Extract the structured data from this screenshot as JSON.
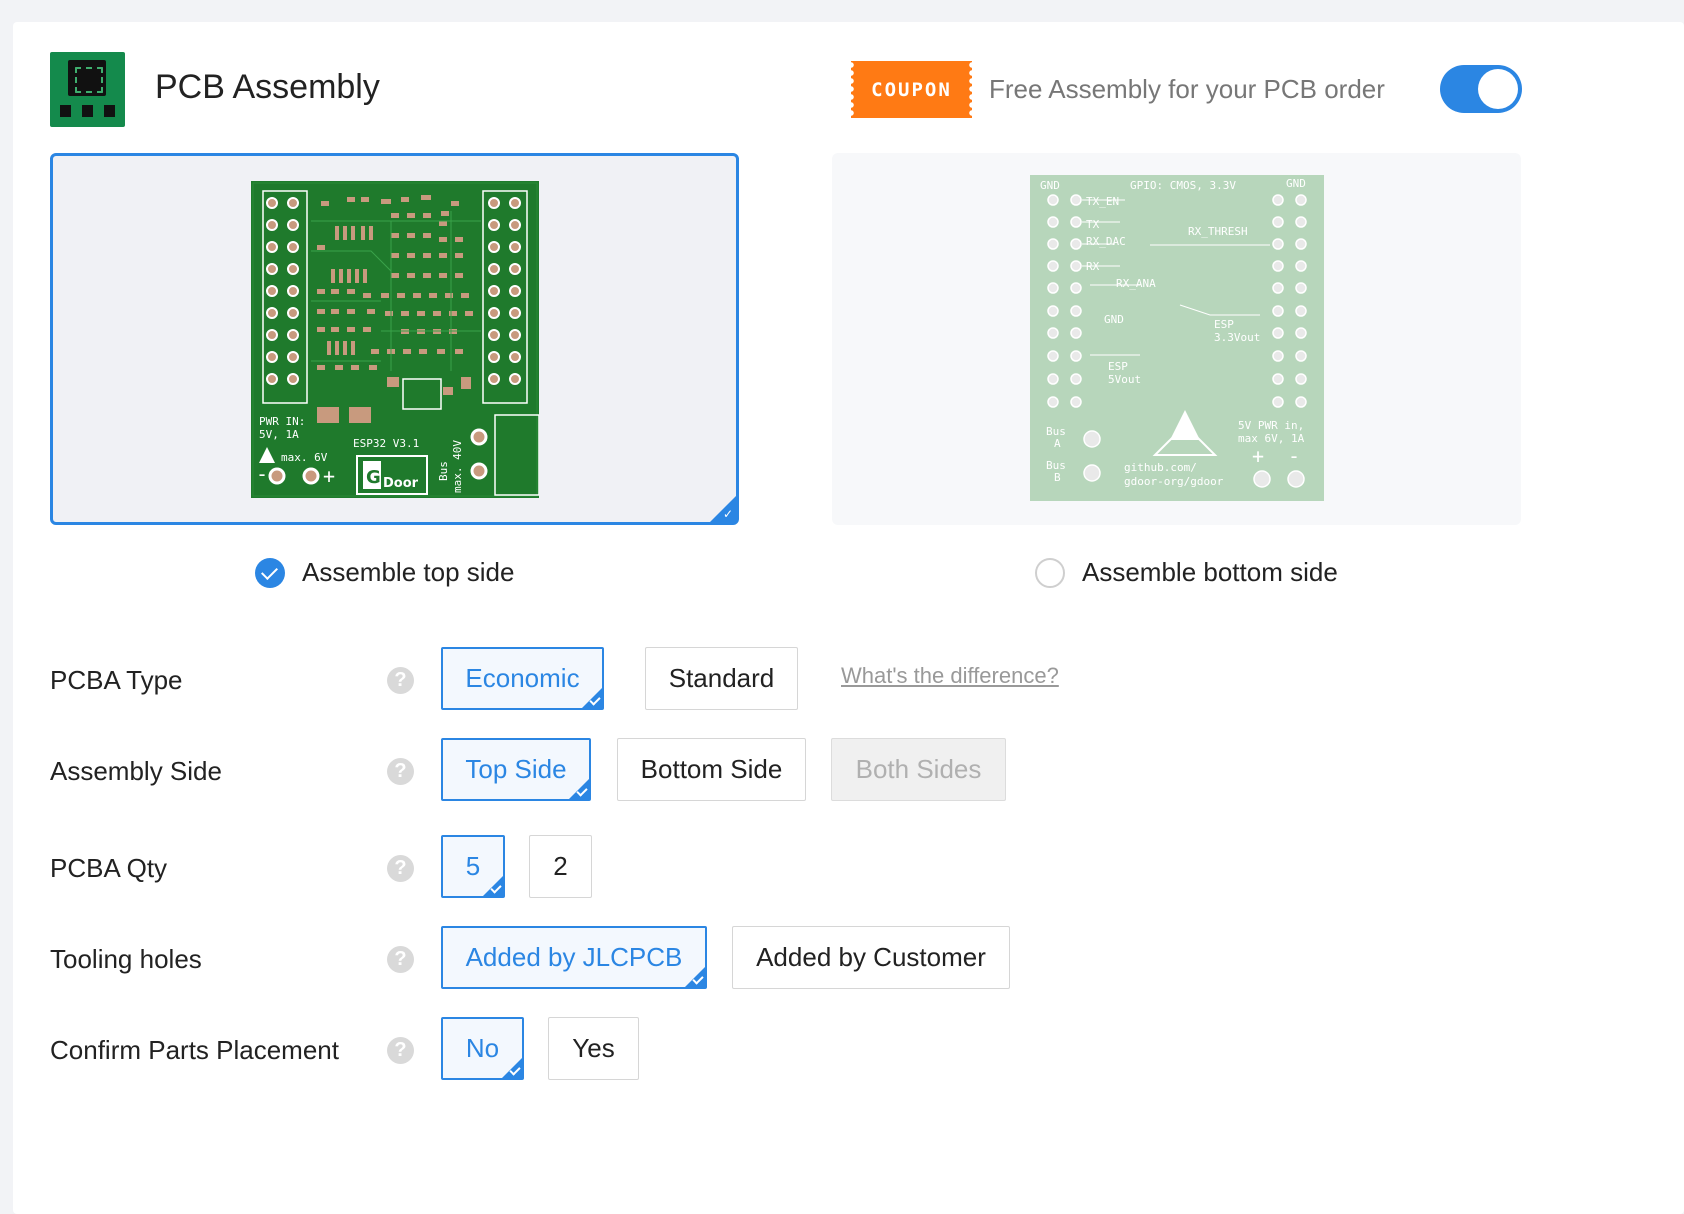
{
  "header": {
    "title": "PCB Assembly",
    "coupon_badge": "COUPON",
    "coupon_text": "Free Assembly for your PCB order",
    "toggle_on": true
  },
  "sides": {
    "top_label": "Assemble top side",
    "bottom_label": "Assemble bottom side",
    "selected": "top",
    "top_pcb_text": [
      "PWR IN:",
      "5V, 1A",
      "max. 6V",
      "ESP32 V3.1",
      "Bus",
      "max. 40V",
      "GDoor"
    ],
    "bottom_pcb_text": [
      "GND",
      "GPIO: CMOS, 3.3V",
      "GND",
      "TX_EN",
      "TX",
      "RX_DAC",
      "RX_THRESH",
      "RX",
      "RX_ANA",
      "GND",
      "ESP",
      "3.3Vout",
      "ESP",
      "5Vout",
      "Bus",
      "A",
      "Bus",
      "B",
      "5V PWR in,",
      "max 6V, 1A",
      "github.com/",
      "gdoor-org/gdoor"
    ]
  },
  "options": {
    "pcba_type": {
      "label": "PCBA Type",
      "choices": [
        "Economic",
        "Standard"
      ],
      "selected": "Economic",
      "link": "What's the difference?"
    },
    "assembly_side": {
      "label": "Assembly Side",
      "choices": [
        "Top Side",
        "Bottom Side",
        "Both Sides"
      ],
      "selected": "Top Side",
      "disabled": "Both Sides"
    },
    "pcba_qty": {
      "label": "PCBA Qty",
      "choices": [
        "5",
        "2"
      ],
      "selected": "5"
    },
    "tooling_holes": {
      "label": "Tooling holes",
      "choices": [
        "Added by JLCPCB",
        "Added by Customer"
      ],
      "selected": "Added by JLCPCB"
    },
    "confirm_parts": {
      "label": "Confirm Parts Placement",
      "choices": [
        "No",
        "Yes"
      ],
      "selected": "No"
    }
  },
  "help_glyph": "?"
}
